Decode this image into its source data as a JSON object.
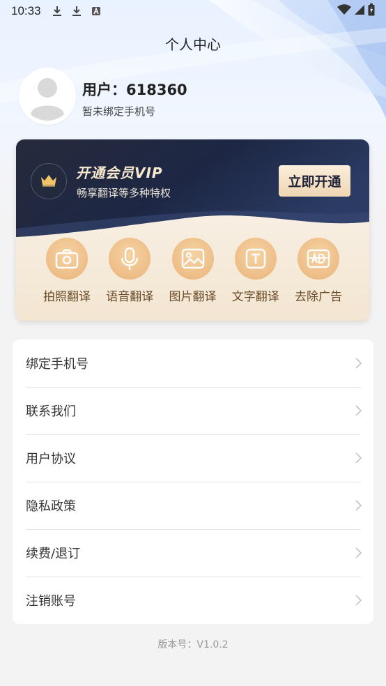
{
  "status_bar": {
    "time": "10:33",
    "icons": [
      "download-icon",
      "download-icon",
      "a-text-icon",
      "wifi-icon",
      "signal-icon",
      "battery-charging-icon"
    ]
  },
  "header": {
    "title": "个人中心"
  },
  "profile": {
    "username": "用户：618360",
    "phone_status": "暂未绑定手机号",
    "avatar_icon": "default-avatar-icon"
  },
  "vip": {
    "title": "开通会员VIP",
    "subtitle": "畅享翻译等多种特权",
    "button_label": "立即开通",
    "icon": "crown-icon",
    "colors": {
      "dark": "#1e2438",
      "gold": "#efd6b4",
      "feature_text": "#6a4b28"
    },
    "features": [
      {
        "label": "拍照翻译",
        "icon": "camera-icon"
      },
      {
        "label": "语音翻译",
        "icon": "microphone-icon"
      },
      {
        "label": "图片翻译",
        "icon": "image-icon"
      },
      {
        "label": "文字翻译",
        "icon": "text-icon"
      },
      {
        "label": "去除广告",
        "icon": "remove-ad-icon"
      }
    ]
  },
  "menu": {
    "items": [
      {
        "label": "绑定手机号"
      },
      {
        "label": "联系我们"
      },
      {
        "label": "用户协议"
      },
      {
        "label": "隐私政策"
      },
      {
        "label": "续费/退订"
      },
      {
        "label": "注销账号"
      }
    ]
  },
  "footer": {
    "version": "版本号：V1.0.2"
  }
}
